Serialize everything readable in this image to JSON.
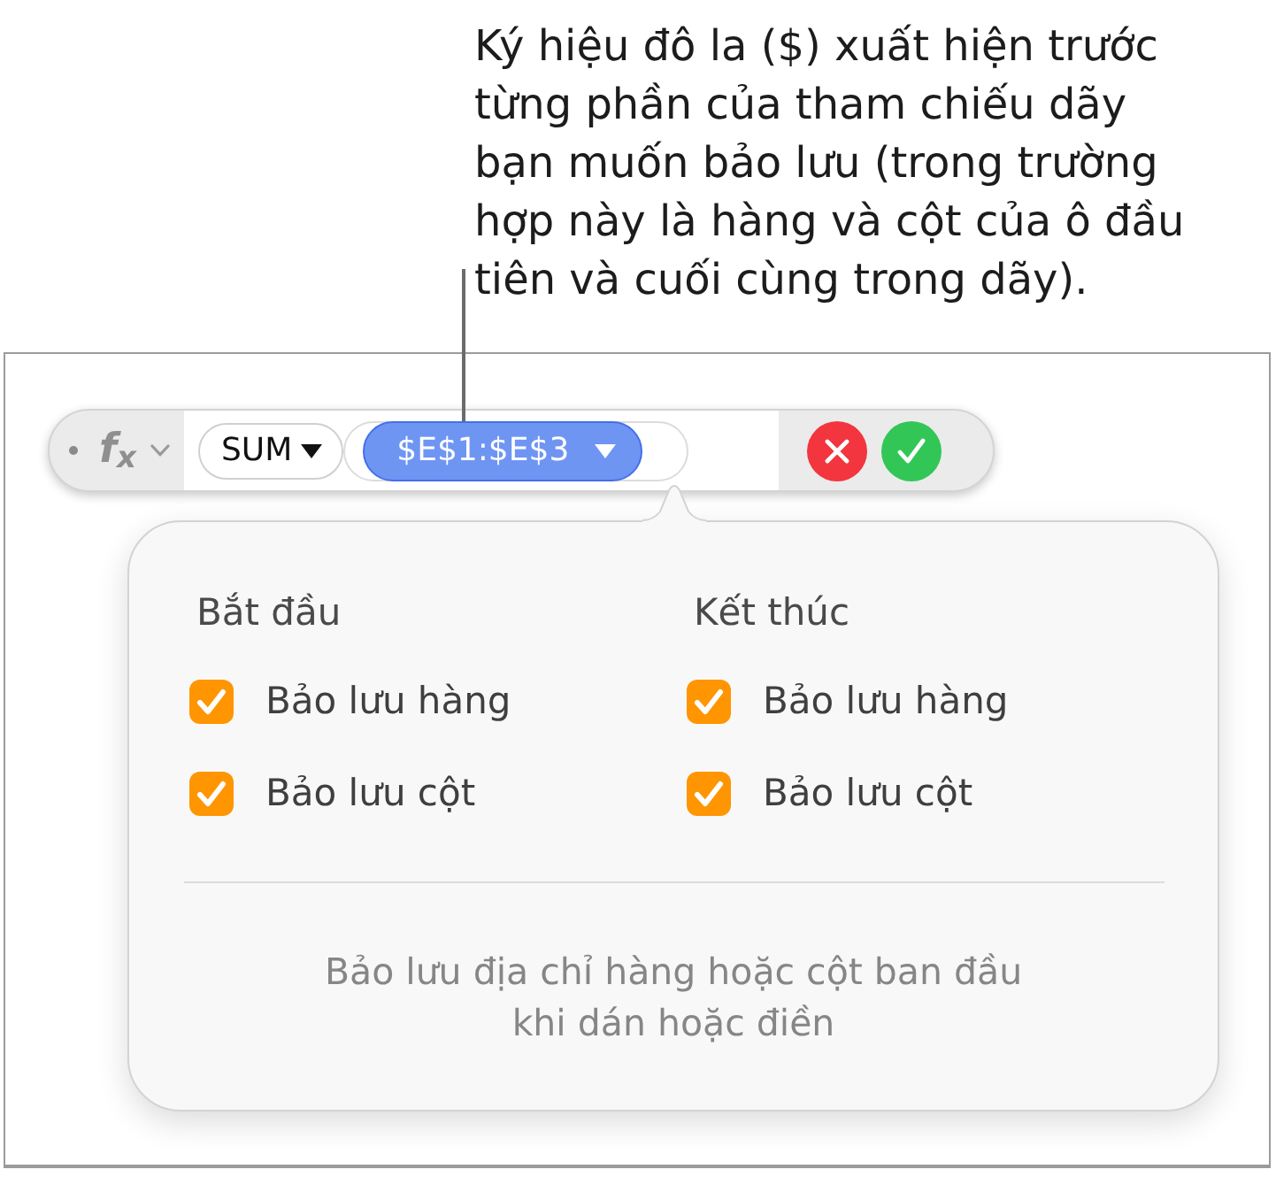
{
  "callout": {
    "text": "Ký hiệu đô la ($) xuất hiện trước\ntừng phần của tham chiếu dãy\nbạn muốn bảo lưu (trong trường\nhợp này là hàng và cột của ô đầu\ntiên và cuối cùng trong dãy)."
  },
  "formula_bar": {
    "function_symbol": "f$_{x}$",
    "tokens": [
      {
        "kind": "function",
        "label": "SUM",
        "selected": false
      },
      {
        "kind": "range",
        "label": "$E$1:$E$3",
        "selected": true
      }
    ]
  },
  "popover": {
    "groups": [
      {
        "heading": "Bắt đầu",
        "options": [
          {
            "label": "Bảo lưu hàng",
            "checked": true
          },
          {
            "label": "Bảo lưu cột",
            "checked": true
          }
        ]
      },
      {
        "heading": "Kết thúc",
        "options": [
          {
            "label": "Bảo lưu hàng",
            "checked": true
          },
          {
            "label": "Bảo lưu cột",
            "checked": true
          }
        ]
      }
    ],
    "note": "Bảo lưu địa chỉ hàng hoặc cột ban đầu\nkhi dán hoặc điền"
  }
}
